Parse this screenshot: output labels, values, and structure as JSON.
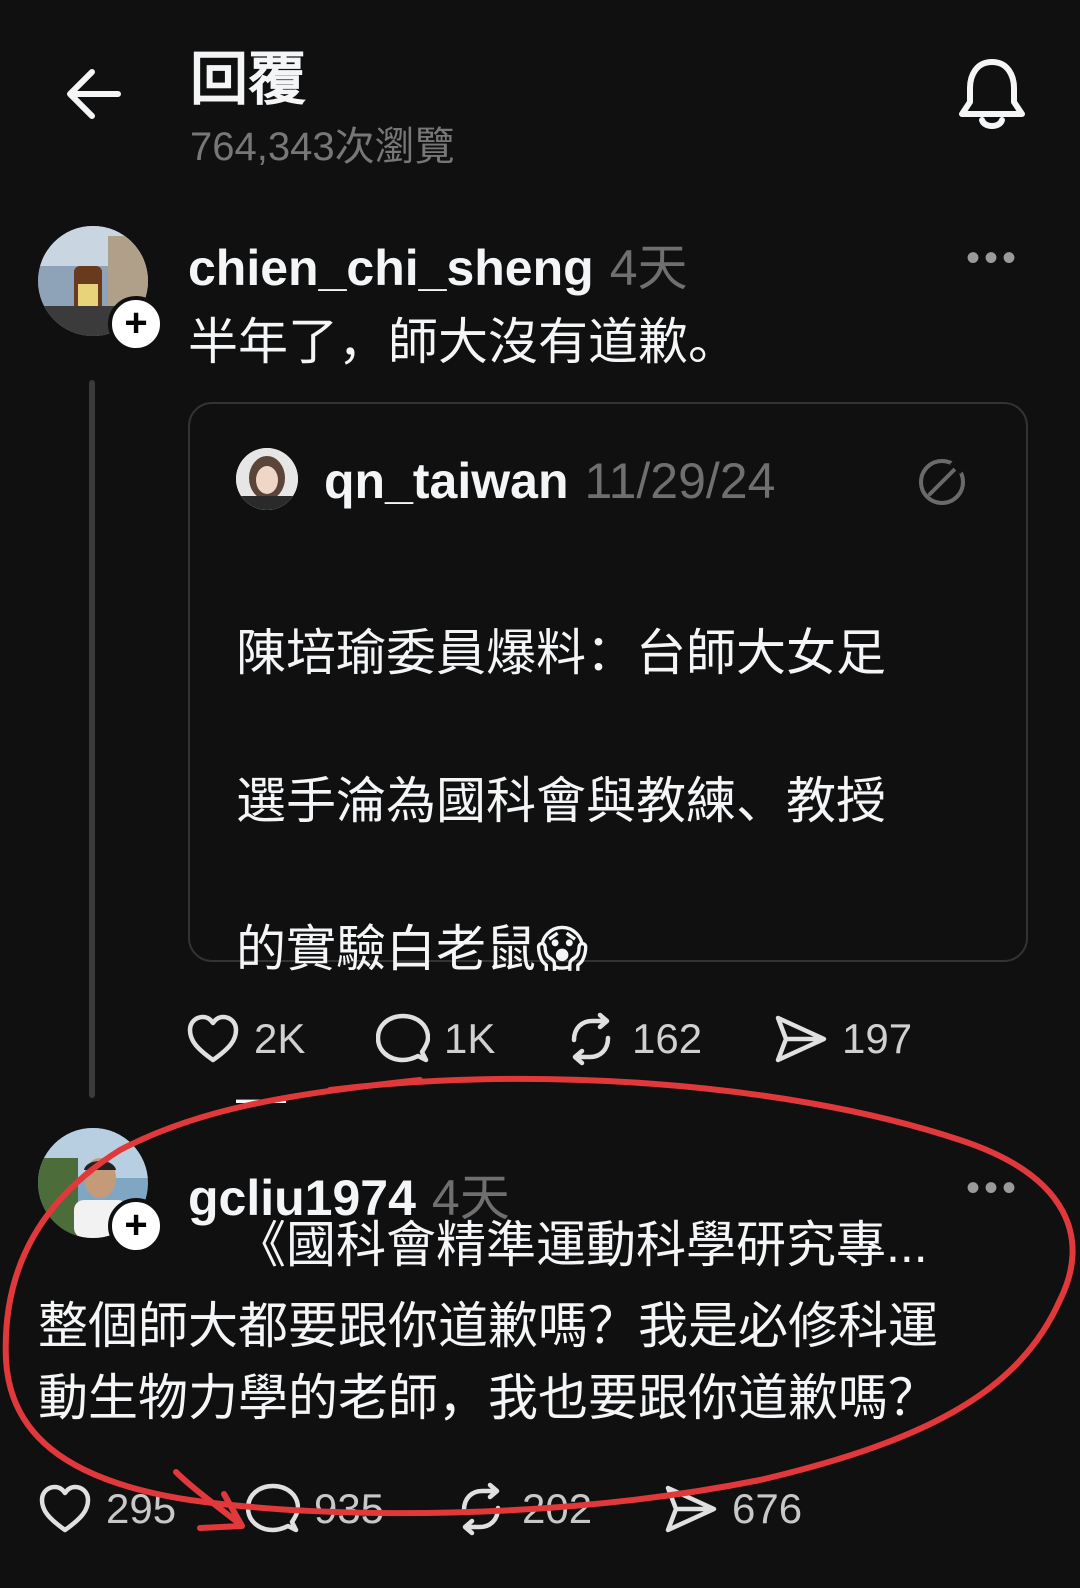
{
  "header": {
    "title": "回覆",
    "views": "764,343次瀏覽"
  },
  "post": {
    "username": "chien_chi_sheng",
    "time": "4天",
    "text": "半年了，師大沒有道歉。",
    "quote": {
      "username": "qn_taiwan",
      "date": "11/29/24",
      "line1": "陳培瑜委員爆料：台師大女足",
      "line2": "選手淪為國科會與教練、教授",
      "line3": "的實驗白老鼠😱",
      "line4": "—",
      "line5": "《國科會精準運動科學研究專..."
    },
    "actions": {
      "likes": "2K",
      "replies": "1K",
      "reposts": "162",
      "shares": "197"
    }
  },
  "reply": {
    "username": "gcliu1974",
    "time": "4天",
    "line1": "整個師大都要跟你道歉嗎？我是必修科運",
    "line2": "動生物力學的老師，我也要跟你道歉嗎？",
    "actions": {
      "likes": "295",
      "replies": "935",
      "reposts": "202",
      "shares": "676"
    }
  },
  "annotation_color": "#e0383b"
}
